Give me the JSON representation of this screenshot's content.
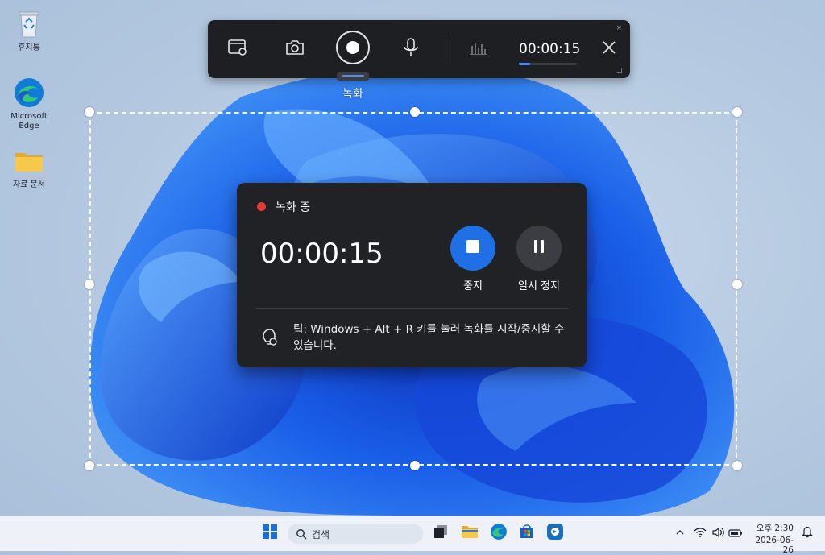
{
  "desktop": {
    "icons": [
      {
        "label": "휴지통",
        "icon": "recycle-bin-icon"
      },
      {
        "label": "Microsoft Edge",
        "icon": "edge-icon"
      },
      {
        "label": "자료 문서",
        "icon": "folder-icon"
      }
    ]
  },
  "toolbar": {
    "buttons": [
      "window-capture-icon",
      "camera-icon",
      "record-icon",
      "microphone-icon",
      "audio-levels-icon",
      "close-icon"
    ],
    "timer": "00:00:15",
    "progress": 0.2,
    "mini_close": "×",
    "mode_label": "녹화"
  },
  "panel": {
    "status": "녹화 중",
    "elapsed": "00:00:15",
    "stop_label": "중지",
    "pause_label": "일시 정지",
    "tip": "팁: Windows + Alt + R 키를 눌러 녹화를 시작/중지할 수 있습니다."
  },
  "taskbar": {
    "search_placeholder": "검색",
    "apps": [
      "start-icon",
      "search-icon",
      "task-view-icon",
      "file-explorer-icon",
      "edge-icon",
      "store-icon",
      "app-icon"
    ],
    "tray": {
      "time_prefix": "오후",
      "time": "2:30",
      "date": "2026-06-26"
    }
  },
  "colors": {
    "accent": "#1f6fe5",
    "record_red": "#e53935",
    "panel_bg": "#202226",
    "toolbar_bg": "#1d1f23"
  }
}
